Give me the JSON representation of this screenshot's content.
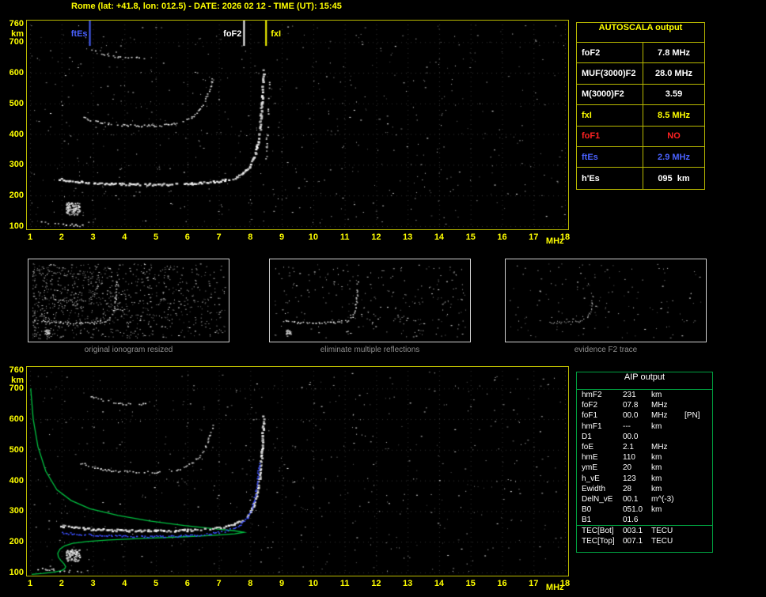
{
  "title": "Rome (lat: +41.8, lon: 012.5) - DATE: 2026 02 12 - TIME (UT): 15:45",
  "ionogram": {
    "y_unit": "km",
    "x_unit": "MHz",
    "y_ticks": [
      760,
      700,
      600,
      500,
      400,
      300,
      200,
      100
    ],
    "x_ticks": [
      1,
      2,
      3,
      4,
      5,
      6,
      7,
      8,
      9,
      10,
      11,
      12,
      13,
      14,
      15,
      16,
      17,
      18
    ],
    "markers": [
      {
        "label": "ftEs",
        "freq": 2.9,
        "color": "#4a62ff",
        "side": "left"
      },
      {
        "label": "foF2",
        "freq": 7.8,
        "color": "#ffffff",
        "side": "left"
      },
      {
        "label": "fxI",
        "freq": 8.5,
        "color": "#ffff00",
        "side": "right"
      }
    ]
  },
  "autoscala": {
    "header": "AUTOSCALA output",
    "rows": [
      {
        "param": "foF2",
        "value": "7.8 MHz",
        "color": "#ffffff"
      },
      {
        "param": "MUF(3000)F2",
        "value": "28.0 MHz",
        "color": "#ffffff"
      },
      {
        "param": "M(3000)F2",
        "value": "3.59",
        "color": "#ffffff"
      },
      {
        "param": "fxI",
        "value": "8.5 MHz",
        "color": "#ffff00"
      },
      {
        "param": "foF1",
        "value": "NO",
        "color": "#ff2222"
      },
      {
        "param": "ftEs",
        "value": "2.9 MHz",
        "color": "#4a62ff"
      },
      {
        "param": "h'Es",
        "value": "095  km",
        "color": "#ffffff"
      }
    ]
  },
  "panels": [
    {
      "caption": "original ionogram resized",
      "render": {
        "seed": 3,
        "noise": 950,
        "leftBias": true,
        "dot": 0.6,
        "traces": [
          "hop3",
          "hop2",
          "mainF",
          "es",
          "esblob"
        ]
      }
    },
    {
      "caption": "eliminate multiple reflections",
      "render": {
        "seed": 4,
        "noise": 260,
        "dot": 0.6,
        "traces": [
          "mainF",
          "esblob"
        ]
      }
    },
    {
      "caption": "evidence F2 trace",
      "render": {
        "seed": 5,
        "noise": 150,
        "dot": 0.6,
        "traces": [
          "f2part"
        ]
      }
    }
  ],
  "aip": {
    "header": "AIP output",
    "rows": [
      {
        "param": "hmF2",
        "value": "231",
        "unit": "km",
        "extra": ""
      },
      {
        "param": "foF2",
        "value": "07.8",
        "unit": "MHz",
        "extra": ""
      },
      {
        "param": "foF1",
        "value": "00.0",
        "unit": "MHz",
        "extra": "[PN]"
      },
      {
        "param": "hmF1",
        "value": "---",
        "unit": "km",
        "extra": ""
      },
      {
        "param": "D1",
        "value": "00.0",
        "unit": "",
        "extra": ""
      },
      {
        "param": "foE",
        "value": "2.1",
        "unit": "MHz",
        "extra": ""
      },
      {
        "param": "hmE",
        "value": "110",
        "unit": "km",
        "extra": ""
      },
      {
        "param": "ymE",
        "value": "20",
        "unit": "km",
        "extra": ""
      },
      {
        "param": "h_vE",
        "value": "123",
        "unit": "km",
        "extra": ""
      },
      {
        "param": "Ewidth",
        "value": "28",
        "unit": "km",
        "extra": ""
      },
      {
        "param": "DelN_vE",
        "value": "00.1",
        "unit": "m^(-3)",
        "extra": ""
      },
      {
        "param": "B0",
        "value": "051.0",
        "unit": "km",
        "extra": ""
      },
      {
        "param": "B1",
        "value": "01.6",
        "unit": "",
        "extra": ""
      },
      {
        "param": "TEC[Bot]",
        "value": "003.1",
        "unit": "TECU",
        "extra": "",
        "sep": true
      },
      {
        "param": "TEC[Top]",
        "value": "007.1",
        "unit": "TECU",
        "extra": ""
      }
    ]
  },
  "traces": {
    "hop3": {
      "size": 2,
      "gap": 0.45,
      "points": [
        [
          2.9,
          678
        ],
        [
          3.3,
          663
        ],
        [
          3.8,
          653
        ],
        [
          4.3,
          649
        ],
        [
          4.7,
          651
        ]
      ]
    },
    "hop2": {
      "size": 2,
      "gap": 0.28,
      "points": [
        [
          2.6,
          458
        ],
        [
          3.0,
          443
        ],
        [
          3.6,
          433
        ],
        [
          4.4,
          428
        ],
        [
          5.1,
          429
        ],
        [
          5.7,
          437
        ],
        [
          6.1,
          455
        ],
        [
          6.45,
          490
        ],
        [
          6.65,
          535
        ],
        [
          6.8,
          585
        ]
      ]
    },
    "mainF": {
      "size": 3,
      "gap": 0.16,
      "points": [
        [
          1.9,
          256
        ],
        [
          2.3,
          248
        ],
        [
          2.9,
          243
        ],
        [
          3.6,
          240
        ],
        [
          4.5,
          238
        ],
        [
          5.4,
          238
        ],
        [
          6.2,
          241
        ],
        [
          6.9,
          247
        ],
        [
          7.4,
          256
        ],
        [
          7.7,
          270
        ],
        [
          7.95,
          293
        ],
        [
          8.1,
          325
        ],
        [
          8.2,
          365
        ],
        [
          8.28,
          420
        ],
        [
          8.33,
          485
        ],
        [
          8.37,
          555
        ],
        [
          8.4,
          615
        ]
      ]
    },
    "f2part": {
      "size": 2,
      "gap": 0.2,
      "points": [
        [
          4.6,
          238
        ],
        [
          5.4,
          238
        ],
        [
          6.2,
          241
        ],
        [
          6.9,
          247
        ],
        [
          7.4,
          256
        ],
        [
          7.7,
          270
        ],
        [
          7.95,
          293
        ],
        [
          8.1,
          325
        ],
        [
          8.2,
          365
        ],
        [
          8.28,
          420
        ],
        [
          8.33,
          485
        ]
      ]
    },
    "es": {
      "size": 2,
      "gap": 0.5,
      "points": [
        [
          1.25,
          114
        ],
        [
          1.7,
          110
        ],
        [
          2.2,
          106
        ],
        [
          2.7,
          103
        ]
      ]
    },
    "esblob": {
      "blob": [
        2.35,
        158,
        0.22,
        20
      ],
      "count": 90
    },
    "xmode": {
      "size": 2,
      "gap": 0.55,
      "points": [
        [
          8.48,
          320
        ],
        [
          8.52,
          400
        ],
        [
          8.55,
          470
        ],
        [
          8.58,
          545
        ],
        [
          8.6,
          605
        ]
      ]
    },
    "blueTrace": {
      "color": "#3c50ff",
      "size": 2,
      "gap": 0.12,
      "points": [
        [
          2.0,
          230
        ],
        [
          2.8,
          224
        ],
        [
          3.8,
          220
        ],
        [
          4.8,
          218
        ],
        [
          5.8,
          220
        ],
        [
          6.6,
          226
        ],
        [
          7.2,
          236
        ],
        [
          7.6,
          252
        ],
        [
          7.9,
          280
        ],
        [
          8.05,
          315
        ],
        [
          8.15,
          355
        ],
        [
          8.22,
          405
        ],
        [
          8.27,
          460
        ]
      ]
    },
    "profile": {
      "color": "#00c040",
      "points": [
        [
          1.02,
          700
        ],
        [
          1.1,
          600
        ],
        [
          1.25,
          510
        ],
        [
          1.5,
          430
        ],
        [
          1.85,
          370
        ],
        [
          2.3,
          335
        ],
        [
          2.9,
          308
        ],
        [
          3.8,
          286
        ],
        [
          4.8,
          268
        ],
        [
          5.9,
          253
        ],
        [
          6.9,
          242
        ],
        [
          7.5,
          236
        ],
        [
          7.8,
          231
        ],
        [
          7.5,
          226
        ],
        [
          6.8,
          221
        ],
        [
          5.8,
          216
        ],
        [
          4.6,
          211
        ],
        [
          3.5,
          206
        ],
        [
          2.8,
          201
        ],
        [
          2.35,
          195
        ],
        [
          2.1,
          187
        ],
        [
          1.95,
          176
        ],
        [
          1.88,
          163
        ],
        [
          1.9,
          150
        ],
        [
          1.98,
          139
        ],
        [
          2.08,
          128
        ],
        [
          2.13,
          119
        ],
        [
          2.1,
          112
        ],
        [
          2.0,
          106
        ],
        [
          1.75,
          101
        ],
        [
          1.4,
          97
        ],
        [
          1.05,
          94
        ]
      ]
    }
  },
  "colors": {
    "accent_yellow": "#ffff00",
    "frame_yellow": "#b9b900",
    "green": "#00c040",
    "blue": "#4a62ff",
    "red": "#ff2222",
    "panel_border": "#cfcfcf",
    "caption_gray": "#8f8f8f"
  }
}
